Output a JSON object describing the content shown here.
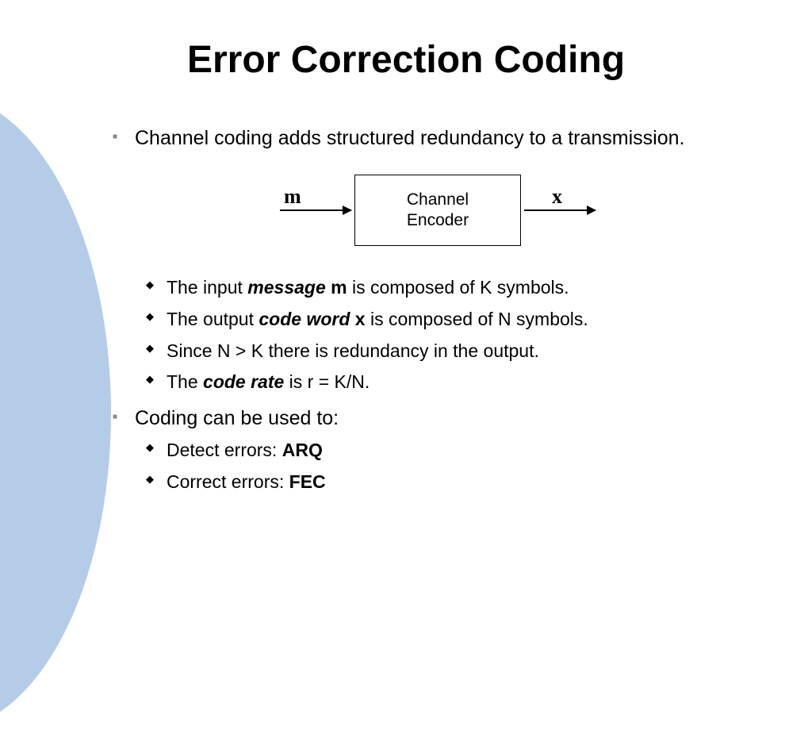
{
  "title": "Error Correction Coding",
  "bullets": {
    "main1": "Channel coding adds structured redundancy to a transmission.",
    "main2": "Coding can be used to:"
  },
  "diagram": {
    "input_label": "m",
    "output_label": "x",
    "box_line1": "Channel",
    "box_line2": "Encoder"
  },
  "sub1": {
    "a_pre": "The input ",
    "a_bi": "message",
    "a_mid": " ",
    "a_b": "m",
    "a_post": " is composed of K symbols.",
    "b_pre": "The output ",
    "b_bi": "code word",
    "b_mid": " ",
    "b_b": "x",
    "b_post": " is composed of N symbols.",
    "c": "Since N > K there is redundancy in the output.",
    "d_pre": "The ",
    "d_bi": "code rate",
    "d_post": " is r = K/N."
  },
  "sub2": {
    "a_pre": "Detect errors: ",
    "a_b": "ARQ",
    "b_pre": "Correct errors: ",
    "b_b": "FEC"
  }
}
